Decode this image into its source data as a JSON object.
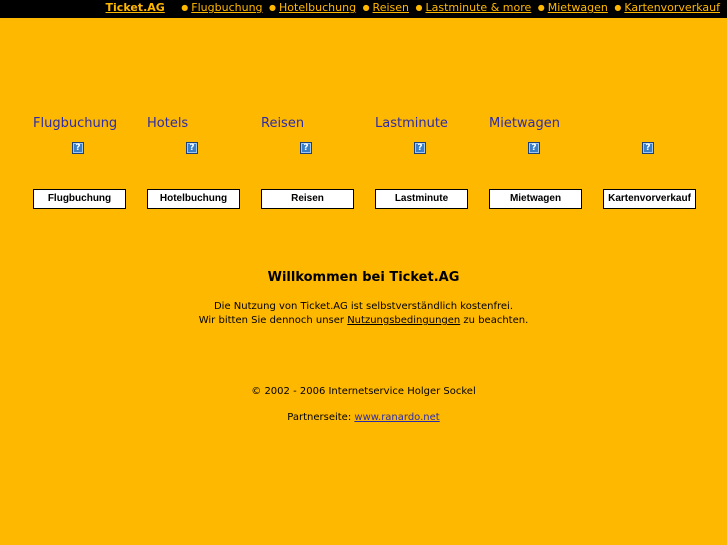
{
  "colors": {
    "background": "#FFB800",
    "topbar": "#000000",
    "title_text": "#2C2CA8"
  },
  "topnav": {
    "brand": "Ticket.AG",
    "links": [
      "Flugbuchung",
      "Hotelbuchung",
      "Reisen",
      "Lastminute & more",
      "Mietwagen",
      "Kartenvorverkauf"
    ]
  },
  "categories": [
    {
      "title": "Flugbuchung",
      "icon": "broken-image-icon",
      "button": "Flugbuchung"
    },
    {
      "title": "Hotels",
      "icon": "broken-image-icon",
      "button": "Hotelbuchung"
    },
    {
      "title": "Reisen",
      "icon": "broken-image-icon",
      "button": "Reisen"
    },
    {
      "title": "Lastminute",
      "icon": "broken-image-icon",
      "button": "Lastminute"
    },
    {
      "title": "Mietwagen",
      "icon": "broken-image-icon",
      "button": "Mietwagen"
    },
    {
      "title": "",
      "icon": "broken-image-icon",
      "button": "Kartenvorverkauf"
    }
  ],
  "icon_glyph": "?",
  "welcome": {
    "heading": "Willkommen bei Ticket.AG",
    "line1": "Die Nutzung von Ticket.AG ist selbstverständlich kostenfrei.",
    "line2_before": "Wir bitten Sie dennoch unser ",
    "line2_link": "Nutzungsbedingungen",
    "line2_after": " zu beachten."
  },
  "footer": {
    "copyright": "© 2002 - 2006 Internetservice Holger Sockel",
    "partner_label": "Partnerseite: ",
    "partner_link": "www.ranardo.net"
  }
}
